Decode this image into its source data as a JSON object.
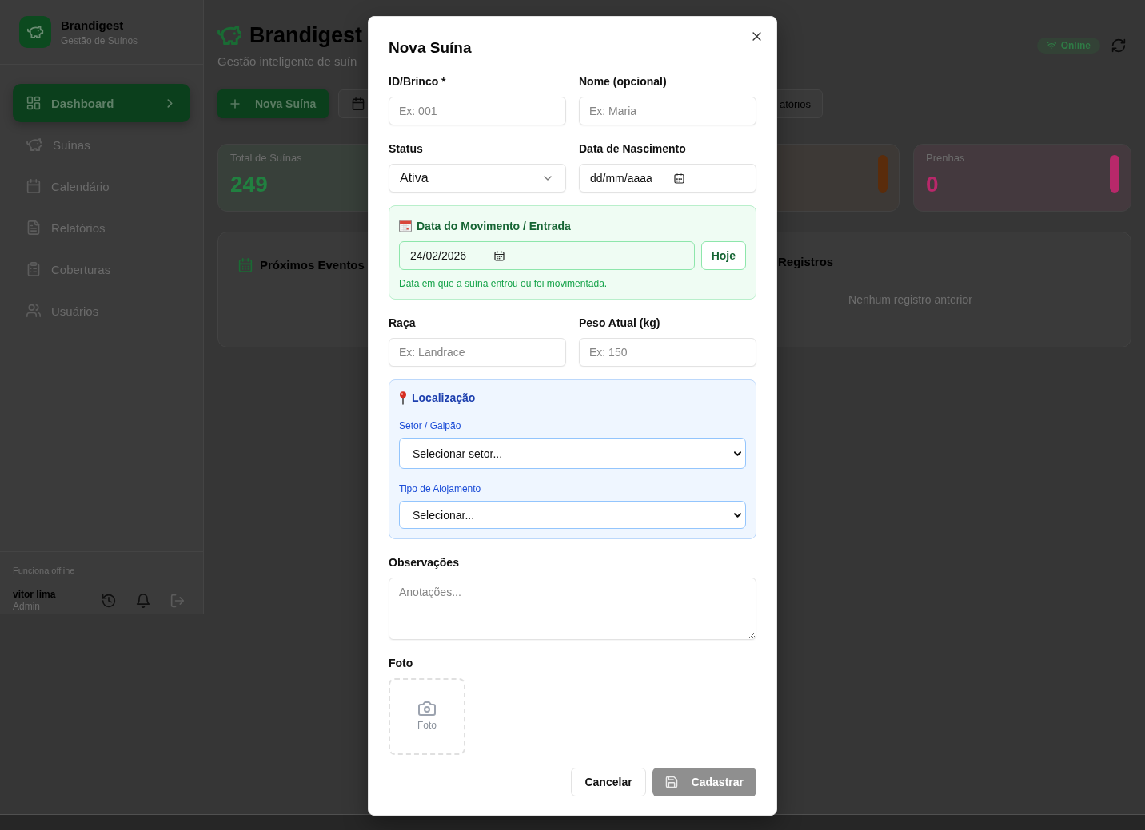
{
  "sidebar": {
    "brand": {
      "title": "Brandigest",
      "subtitle": "Gestão de Suínos"
    },
    "nav": [
      {
        "label": "Dashboard",
        "selected": true
      },
      {
        "label": "Suínas",
        "selected": false
      },
      {
        "label": "Calendário",
        "selected": false
      },
      {
        "label": "Relatórios",
        "selected": false
      },
      {
        "label": "Coberturas",
        "selected": false
      },
      {
        "label": "Usuários",
        "selected": false
      }
    ],
    "footer": {
      "note": "Funciona offline",
      "user": {
        "name": "vitor lima",
        "role": "Admin"
      }
    }
  },
  "header": {
    "title": "Brandigest",
    "subtitle": "Gestão inteligente de suín",
    "connection": {
      "label": "Online",
      "online": true
    }
  },
  "actions": [
    {
      "kind": "primary",
      "label": "Nova Suína"
    },
    {
      "kind": "icon"
    },
    {
      "kind": "outline",
      "label": "atórios"
    }
  ],
  "stats": [
    {
      "kind": "numeric",
      "label": "Total de Suínas",
      "value": "249",
      "color": "#218040"
    },
    {
      "kind": "bar",
      "color": "#5a2c0b"
    },
    {
      "kind": "combined",
      "label": "Prenhas",
      "value": "0",
      "color": "#b8286a"
    }
  ],
  "panels": [
    {
      "title": "Próximos Eventos"
    },
    {
      "title": "Registros",
      "empty_text": "Nenhum registro anterior"
    }
  ],
  "modal": {
    "title": "Nova Suína",
    "sections": [
      {
        "kind": "pair",
        "fields": [
          {
            "kind": "text",
            "label": "ID/Brinco *",
            "placeholder": "Ex: 001"
          },
          {
            "kind": "text",
            "label": "Nome (opcional)",
            "placeholder": "Ex: Maria"
          }
        ]
      },
      {
        "kind": "pair",
        "fields": [
          {
            "kind": "select",
            "label": "Status",
            "value": "Ativa"
          },
          {
            "kind": "date",
            "label": "Data de Nascimento",
            "placeholder": "dd/mm/aaaa"
          }
        ]
      },
      {
        "kind": "movement",
        "title": "Data do Movimento / Entrada",
        "value": "24/02/2026",
        "button": "Hoje",
        "hint": "Data em que a suína entrou ou foi movimentada."
      },
      {
        "kind": "pair",
        "fields": [
          {
            "kind": "text",
            "label": "Raça",
            "placeholder": "Ex: Landrace"
          },
          {
            "kind": "text",
            "label": "Peso Atual (kg)",
            "placeholder": "Ex: 150"
          }
        ]
      },
      {
        "kind": "location",
        "title": "Localização",
        "selects": [
          {
            "label": "Setor / Galpão",
            "value": "Selecionar setor..."
          },
          {
            "label": "Tipo de Alojamento",
            "value": "Selecionar..."
          }
        ]
      },
      {
        "kind": "notes",
        "label": "Observações",
        "placeholder": "Anotações..."
      },
      {
        "kind": "photo",
        "label": "Foto",
        "button": "Foto"
      }
    ],
    "buttons": [
      {
        "kind": "secondary",
        "label": "Cancelar",
        "disabled": false
      },
      {
        "kind": "submit",
        "label": "Cadastrar",
        "disabled": true
      }
    ]
  }
}
